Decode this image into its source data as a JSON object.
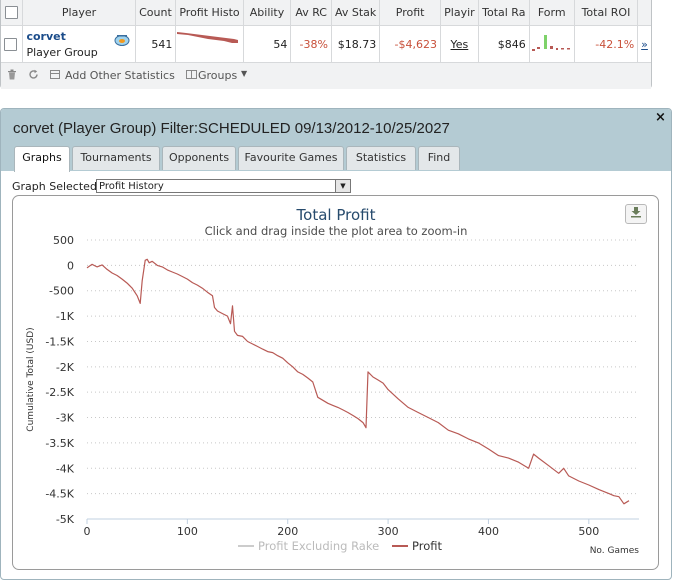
{
  "stats_table": {
    "headers": [
      "Player",
      "Count",
      "Profit Histo",
      "Ability",
      "Av RC",
      "Av Stak",
      "Profit",
      "Playir",
      "Total Ra",
      "Form",
      "Total ROI"
    ],
    "row": {
      "player_name": "corvet",
      "player_type": "Player Group",
      "count": "541",
      "ability": "54",
      "av_roi": "-38%",
      "av_stake": "$18.73",
      "profit": "-$4,623",
      "playing": "Yes",
      "total_rake": "$846",
      "total_roi": "-42.1%",
      "more": "»"
    },
    "toolbar": {
      "add_stats": "Add Other Statistics",
      "groups": "Groups"
    }
  },
  "dialog": {
    "title": "corvet (Player Group) Filter:SCHEDULED 09/13/2012-10/25/2027",
    "close": "×",
    "tabs": [
      "Graphs",
      "Tournaments",
      "Opponents",
      "Favourite Games",
      "Statistics",
      "Find"
    ],
    "active_tab": "Graphs",
    "graph_selected_label": "Graph Selected:",
    "graph_selected_value": "Profit History"
  },
  "colors": {
    "profit": "#b85a55",
    "profit_excl_rake": "#cccccc",
    "title": "#274b6d",
    "header_bg": "#b4cbd3"
  },
  "chart_data": {
    "type": "line",
    "title": "Total Profit",
    "subtitle": "Click and drag inside the plot area to zoom-in",
    "xlabel": "No. Games",
    "ylabel": "Cumulative Total (USD)",
    "xlim": [
      0,
      550
    ],
    "ylim": [
      -5000,
      500
    ],
    "x_ticks": [
      0,
      100,
      200,
      300,
      400,
      500
    ],
    "y_ticks": [
      500,
      0,
      -500,
      -1000,
      -1500,
      -2000,
      -2500,
      -3000,
      -3500,
      -4000,
      -4500,
      -5000
    ],
    "y_tick_labels": [
      "500",
      "0",
      "-500",
      "-1K",
      "-1.5K",
      "-2K",
      "-2.5K",
      "-3K",
      "-3.5K",
      "-4K",
      "-4.5K",
      "-5K"
    ],
    "legend": [
      "Profit Excluding Rake",
      "Profit"
    ],
    "series": [
      {
        "name": "Profit",
        "x": [
          0,
          5,
          10,
          15,
          20,
          25,
          30,
          35,
          40,
          45,
          50,
          53,
          55,
          58,
          60,
          62,
          65,
          70,
          75,
          80,
          85,
          90,
          95,
          100,
          105,
          110,
          115,
          120,
          125,
          127,
          130,
          135,
          140,
          143,
          145,
          147,
          150,
          155,
          160,
          165,
          170,
          175,
          180,
          185,
          190,
          195,
          200,
          205,
          210,
          215,
          220,
          225,
          230,
          235,
          240,
          245,
          250,
          255,
          260,
          265,
          270,
          275,
          278,
          280,
          285,
          290,
          295,
          300,
          310,
          320,
          330,
          340,
          350,
          360,
          370,
          380,
          390,
          400,
          410,
          420,
          430,
          440,
          445,
          450,
          460,
          470,
          475,
          480,
          490,
          500,
          510,
          520,
          525,
          530,
          535,
          540
        ],
        "y": [
          -50,
          20,
          -30,
          10,
          -80,
          -150,
          -200,
          -270,
          -350,
          -450,
          -600,
          -750,
          -300,
          100,
          120,
          50,
          80,
          0,
          -30,
          -90,
          -130,
          -170,
          -220,
          -270,
          -340,
          -390,
          -450,
          -530,
          -600,
          -830,
          -900,
          -950,
          -1000,
          -1150,
          -800,
          -1300,
          -1380,
          -1400,
          -1500,
          -1550,
          -1600,
          -1650,
          -1700,
          -1720,
          -1780,
          -1830,
          -1920,
          -2000,
          -2100,
          -2150,
          -2220,
          -2300,
          -2600,
          -2660,
          -2720,
          -2760,
          -2800,
          -2850,
          -2900,
          -2960,
          -3020,
          -3100,
          -3200,
          -2100,
          -2200,
          -2260,
          -2320,
          -2450,
          -2630,
          -2800,
          -2900,
          -3000,
          -3100,
          -3250,
          -3320,
          -3420,
          -3500,
          -3620,
          -3750,
          -3800,
          -3880,
          -4000,
          -3720,
          -3800,
          -3950,
          -4100,
          -4000,
          -4150,
          -4250,
          -4330,
          -4420,
          -4500,
          -4540,
          -4560,
          -4700,
          -4640
        ]
      }
    ]
  }
}
